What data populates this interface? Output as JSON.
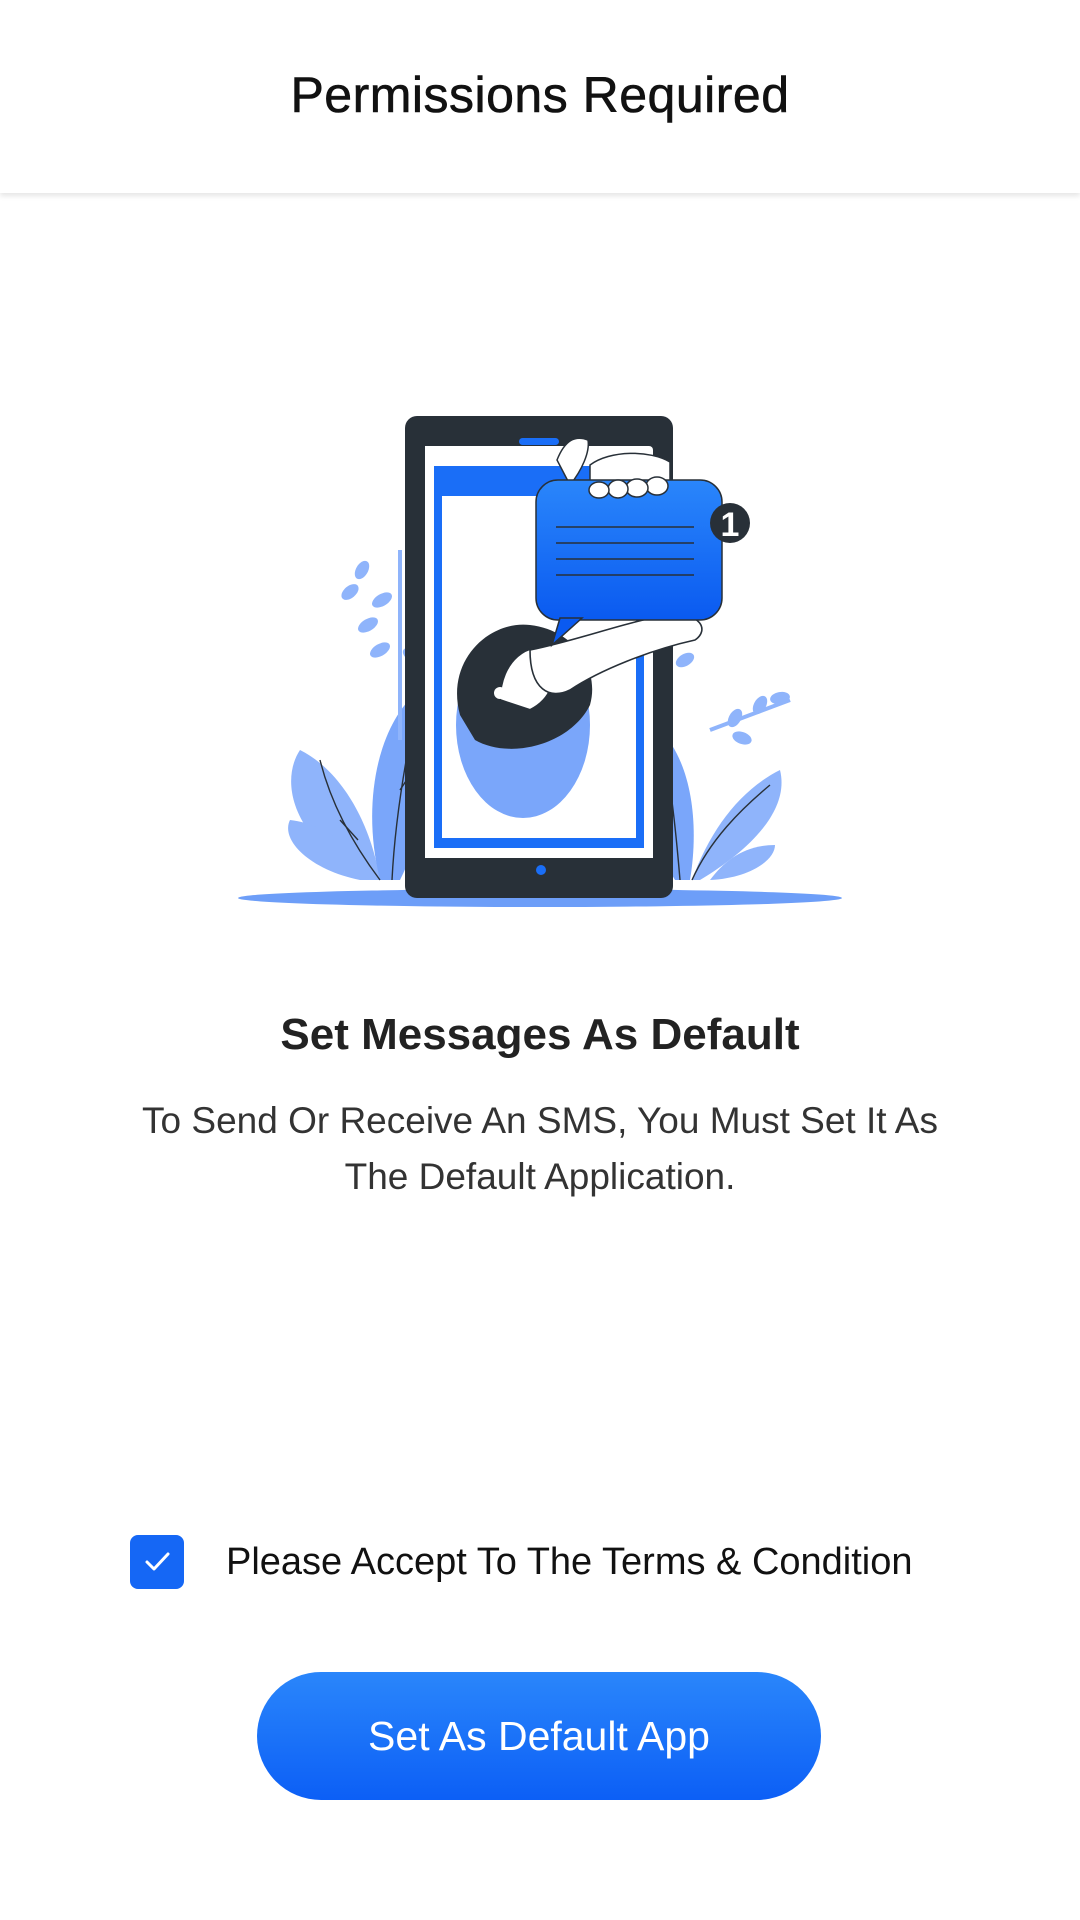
{
  "header": {
    "title": "Permissions Required"
  },
  "main": {
    "title": "Set Messages As Default",
    "description": "To Send Or Receive An SMS, You Must Set It As The Default Application."
  },
  "illustration": {
    "badge_count": "1"
  },
  "terms": {
    "checked": true,
    "label": "Please Accept To The Terms & Condition"
  },
  "actions": {
    "set_default_label": "Set As Default App"
  },
  "colors": {
    "accent": "#1567f5",
    "accent_light": "#2a86fb",
    "leaf": "#8fb4fb",
    "phone_frame": "#283038"
  }
}
